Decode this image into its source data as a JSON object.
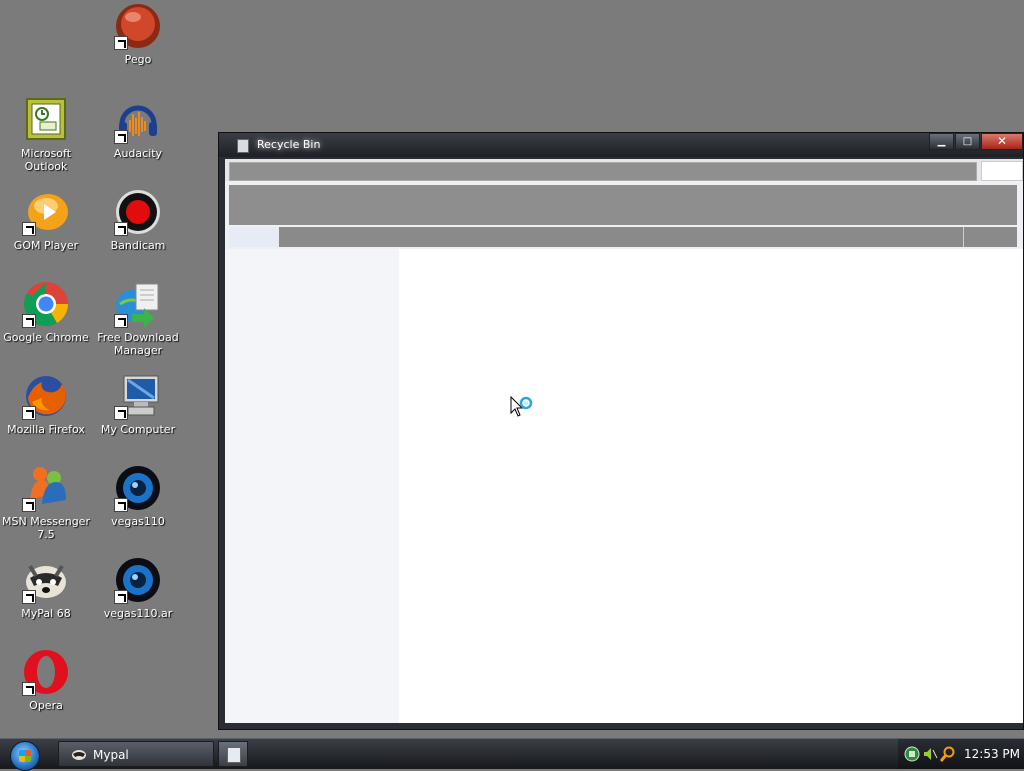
{
  "desktop": {
    "icons": {
      "pego": "Pego",
      "outlook": "Microsoft Outlook",
      "audacity": "Audacity",
      "gom": "GOM Player",
      "bandicam": "Bandicam",
      "chrome": "Google Chrome",
      "fdm": "Free Download Manager",
      "firefox": "Mozilla Firefox",
      "mycomputer": "My Computer",
      "msn": "MSN Messenger 7.5",
      "vegas110": "vegas110",
      "mypal": "MyPal 68",
      "vegas110ar": "vegas110.ar",
      "opera": "Opera"
    }
  },
  "window": {
    "title": "Recycle Bin",
    "controls": {
      "minimize": "▁",
      "maximize": "□",
      "close": "✕"
    }
  },
  "taskbar": {
    "task_label": "Mypal",
    "clock": "12:53 PM"
  },
  "colors": {
    "desktop_bg": "#7b7b7b",
    "close_button": "#c0392b",
    "taskbar": "#1e2126"
  }
}
